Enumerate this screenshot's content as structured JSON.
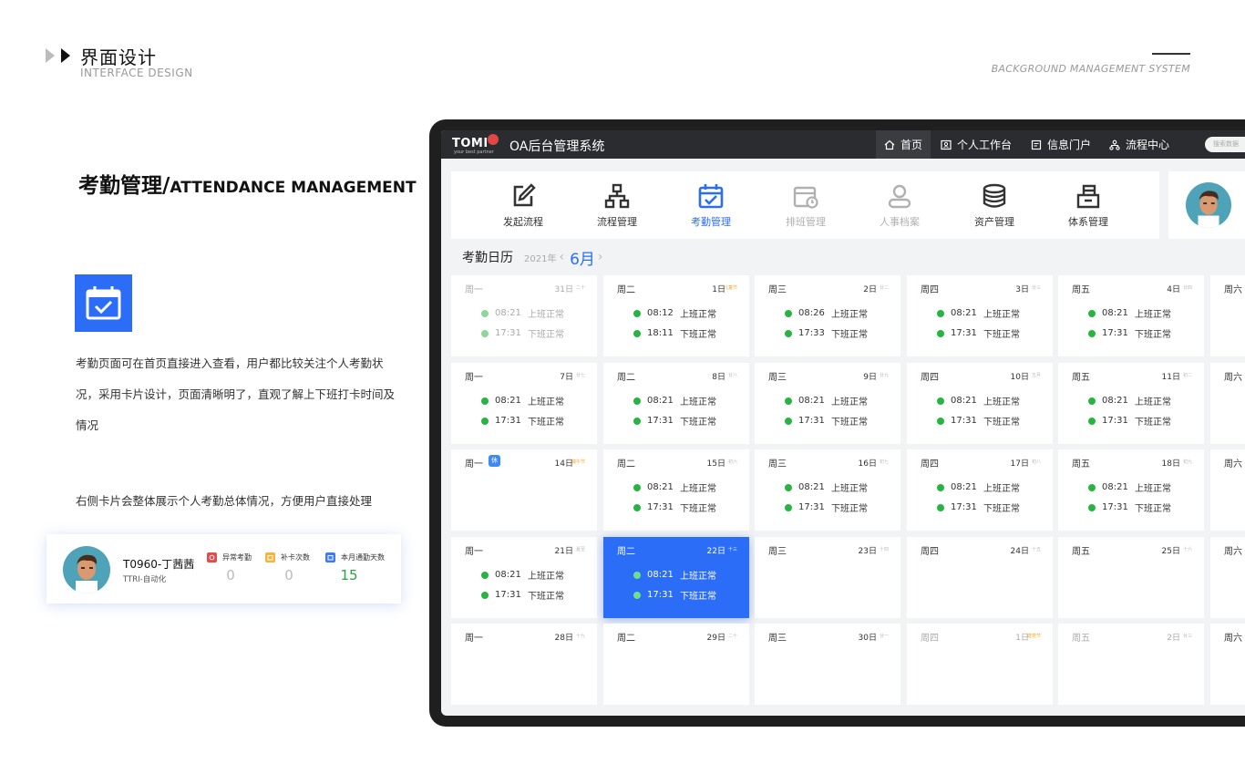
{
  "header": {
    "title": "界面设计",
    "subtitle": "INTERFACE DESIGN",
    "right_text": "BACKGROUND MANAGEMENT SYSTEM"
  },
  "section": {
    "title_cn": "考勤管理/",
    "title_en": "ATTENDANCE MANAGEMENT",
    "desc1": "考勤页面可在首页直接进入查看，用户都比较关注个人考勤状况，采用卡片设计，页面清晰明了，直观了解上下班打卡时间及情况",
    "desc2": "右侧卡片会整体展示个人考勤总体情况，方便用户直接处理"
  },
  "user_card": {
    "name": "T0960-丁茜茜",
    "dept": "TTRI-自动化",
    "stats": [
      {
        "label": "异常考勤",
        "value": "0",
        "color": "#e84a4a"
      },
      {
        "label": "补卡次数",
        "value": "0",
        "color": "#f5b53d"
      },
      {
        "label": "本月通勤天数",
        "value": "15",
        "color": "#3d7af5"
      }
    ]
  },
  "app": {
    "logo": "TOMI",
    "logo_sub": "your best partner",
    "title": "OA后台管理系统",
    "nav": [
      {
        "label": "首页",
        "icon": "home-icon"
      },
      {
        "label": "个人工作台",
        "icon": "user-card-icon"
      },
      {
        "label": "信息门户",
        "icon": "document-icon"
      },
      {
        "label": "流程中心",
        "icon": "flow-icon"
      }
    ],
    "search_placeholder": "搜索数据",
    "menu": [
      {
        "label": "发起流程",
        "icon": "edit-icon",
        "state": "normal"
      },
      {
        "label": "流程管理",
        "icon": "hierarchy-icon",
        "state": "normal"
      },
      {
        "label": "考勤管理",
        "icon": "calendar-check-icon",
        "state": "active"
      },
      {
        "label": "排班管理",
        "icon": "calendar-clock-icon",
        "state": "disabled"
      },
      {
        "label": "人事档案",
        "icon": "person-icon",
        "state": "disabled"
      },
      {
        "label": "资产管理",
        "icon": "coins-icon",
        "state": "normal"
      },
      {
        "label": "体系管理",
        "icon": "box-icon",
        "state": "normal"
      }
    ],
    "calendar": {
      "title": "考勤日历",
      "year": "2021年",
      "month": "6月",
      "rest_badge": "休",
      "rows": [
        [
          {
            "wd": "周一",
            "date": "31日",
            "lunar": "二十",
            "muted": true,
            "in": "08:21",
            "in_s": "上班正常",
            "out": "17:31",
            "out_s": "下班正常"
          },
          {
            "wd": "周二",
            "date": "1日",
            "lunar": "儿童节",
            "hol": true,
            "in": "08:12",
            "in_s": "上班正常",
            "out": "18:11",
            "out_s": "下班正常"
          },
          {
            "wd": "周三",
            "date": "2日",
            "lunar": "廿二",
            "in": "08:26",
            "in_s": "上班正常",
            "out": "17:33",
            "out_s": "下班正常"
          },
          {
            "wd": "周四",
            "date": "3日",
            "lunar": "廿三",
            "in": "08:21",
            "in_s": "上班正常",
            "out": "17:31",
            "out_s": "下班正常"
          },
          {
            "wd": "周五",
            "date": "4日",
            "lunar": "廿四",
            "in": "08:21",
            "in_s": "上班正常",
            "out": "17:31",
            "out_s": "下班正常"
          },
          {
            "wd": "周六"
          }
        ],
        [
          {
            "wd": "周一",
            "date": "7日",
            "lunar": "廿七",
            "in": "08:21",
            "in_s": "上班正常",
            "out": "17:31",
            "out_s": "下班正常"
          },
          {
            "wd": "周二",
            "date": "8日",
            "lunar": "廿八",
            "in": "08:21",
            "in_s": "上班正常",
            "out": "17:31",
            "out_s": "下班正常"
          },
          {
            "wd": "周三",
            "date": "9日",
            "lunar": "廿九",
            "in": "08:21",
            "in_s": "上班正常",
            "out": "17:31",
            "out_s": "下班正常"
          },
          {
            "wd": "周四",
            "date": "10日",
            "lunar": "五月",
            "in": "08:21",
            "in_s": "上班正常",
            "out": "17:31",
            "out_s": "下班正常"
          },
          {
            "wd": "周五",
            "date": "11日",
            "lunar": "初二",
            "in": "08:21",
            "in_s": "上班正常",
            "out": "17:31",
            "out_s": "下班正常"
          },
          {
            "wd": "周六"
          }
        ],
        [
          {
            "wd": "周一",
            "date": "14日",
            "lunar": "端午节",
            "hol": true,
            "rest": true
          },
          {
            "wd": "周二",
            "date": "15日",
            "lunar": "初六",
            "in": "08:21",
            "in_s": "上班正常",
            "out": "17:31",
            "out_s": "下班正常"
          },
          {
            "wd": "周三",
            "date": "16日",
            "lunar": "初七",
            "in": "08:21",
            "in_s": "上班正常",
            "out": "17:31",
            "out_s": "下班正常"
          },
          {
            "wd": "周四",
            "date": "17日",
            "lunar": "初八",
            "in": "08:21",
            "in_s": "上班正常",
            "out": "17:31",
            "out_s": "下班正常"
          },
          {
            "wd": "周五",
            "date": "18日",
            "lunar": "初九",
            "in": "08:21",
            "in_s": "上班正常",
            "out": "17:31",
            "out_s": "下班正常"
          },
          {
            "wd": "周六"
          }
        ],
        [
          {
            "wd": "周一",
            "date": "21日",
            "lunar": "夏至",
            "in": "08:21",
            "in_s": "上班正常",
            "out": "17:31",
            "out_s": "下班正常"
          },
          {
            "wd": "周二",
            "date": "22日",
            "lunar": "十三",
            "sel": true,
            "in": "08:21",
            "in_s": "上班正常",
            "out": "17:31",
            "out_s": "下班正常"
          },
          {
            "wd": "周三",
            "date": "23日",
            "lunar": "十四"
          },
          {
            "wd": "周四",
            "date": "24日",
            "lunar": "十五"
          },
          {
            "wd": "周五",
            "date": "25日",
            "lunar": "十六"
          },
          {
            "wd": "周六"
          }
        ],
        [
          {
            "wd": "周一",
            "date": "28日",
            "lunar": "十九"
          },
          {
            "wd": "周二",
            "date": "29日",
            "lunar": "二十"
          },
          {
            "wd": "周三",
            "date": "30日",
            "lunar": "廿一"
          },
          {
            "wd": "周四",
            "date": "1日",
            "lunar": "建党节",
            "hol": true,
            "muted": true
          },
          {
            "wd": "周五",
            "date": "2日",
            "lunar": "廿三",
            "muted": true
          },
          {
            "wd": "周六"
          }
        ]
      ]
    }
  }
}
